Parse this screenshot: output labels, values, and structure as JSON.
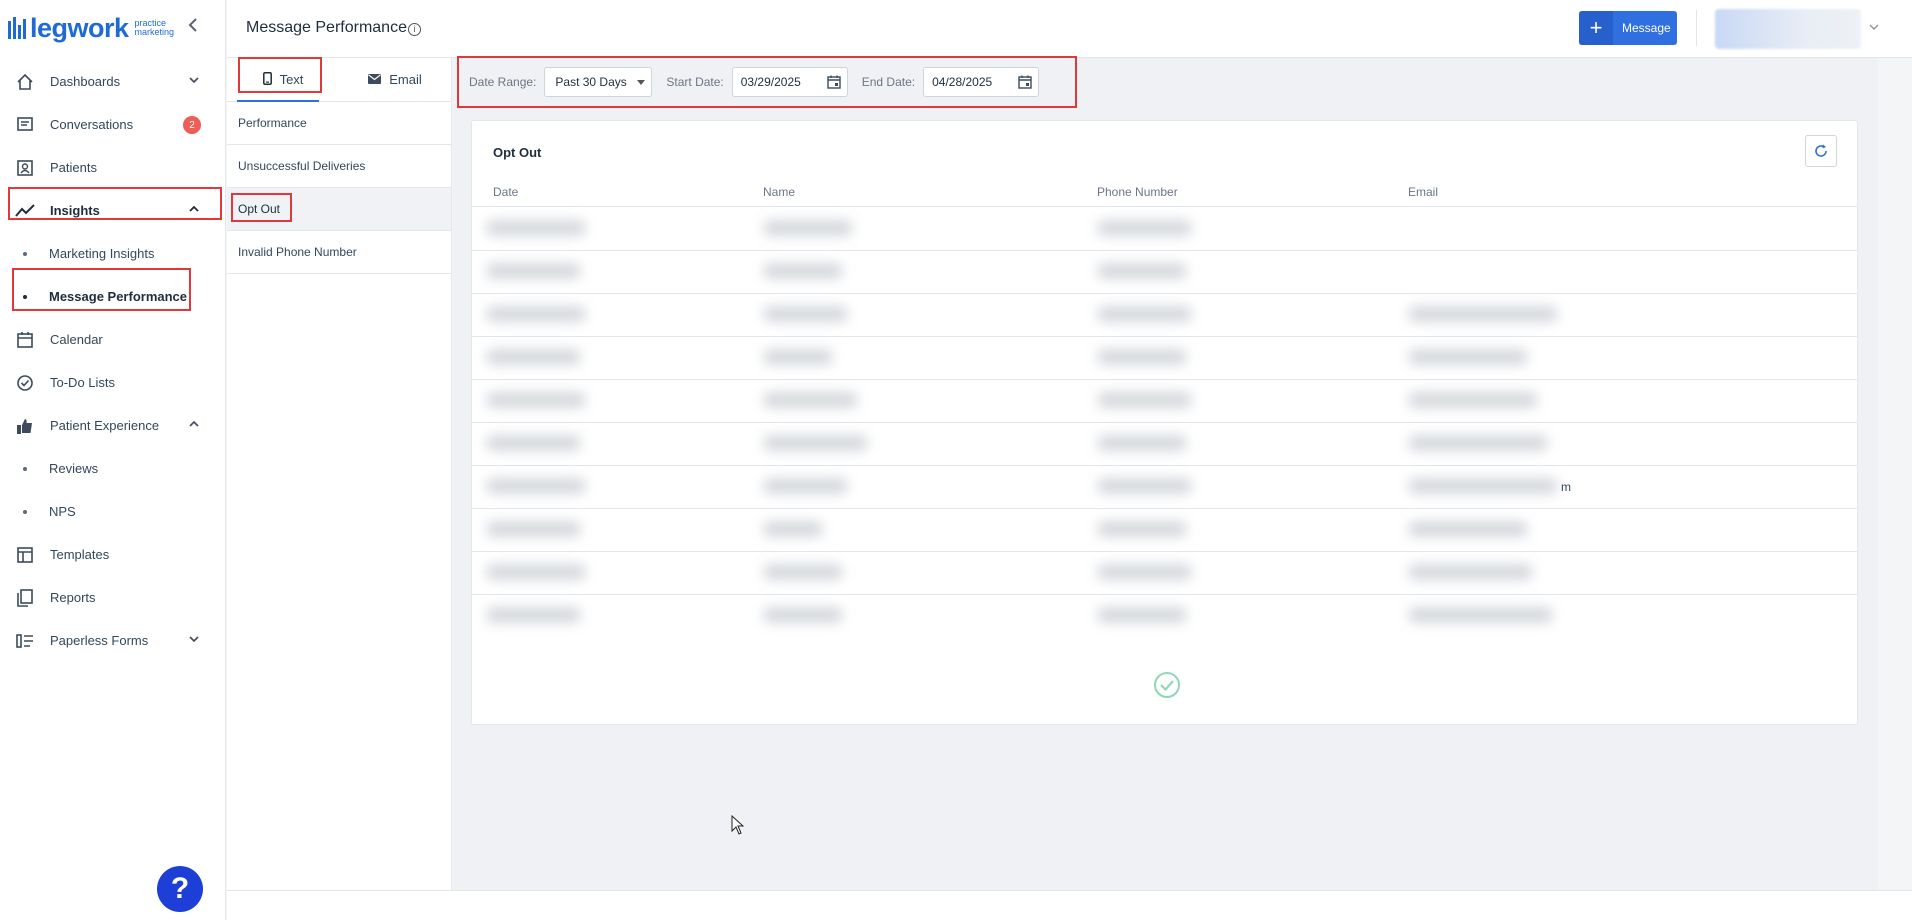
{
  "app": {
    "logo_text": "legwork",
    "logo_sub_1": "practice",
    "logo_sub_2": "marketing"
  },
  "header": {
    "title": "Message Performance",
    "info": "i",
    "message_button": "Message"
  },
  "sidebar": {
    "items": [
      {
        "label": "Dashboards"
      },
      {
        "label": "Conversations",
        "badge": "2"
      },
      {
        "label": "Patients"
      },
      {
        "label": "Insights"
      },
      {
        "label": "Marketing Insights"
      },
      {
        "label": "Message Performance"
      },
      {
        "label": "Calendar"
      },
      {
        "label": "To-Do Lists"
      },
      {
        "label": "Patient Experience"
      },
      {
        "label": "Reviews"
      },
      {
        "label": "NPS"
      },
      {
        "label": "Templates"
      },
      {
        "label": "Reports"
      },
      {
        "label": "Paperless Forms"
      }
    ],
    "help": "?"
  },
  "subnav": {
    "tabs": [
      {
        "label": "Text"
      },
      {
        "label": "Email"
      }
    ],
    "links": [
      {
        "label": "Performance"
      },
      {
        "label": "Unsuccessful Deliveries"
      },
      {
        "label": "Opt Out"
      },
      {
        "label": "Invalid Phone Number"
      }
    ]
  },
  "filters": {
    "date_range_label": "Date Range:",
    "date_range_value": "Past 30 Days",
    "start_label": "Start Date:",
    "start_value": "03/29/2025",
    "end_label": "End Date:",
    "end_value": "04/28/2025"
  },
  "card": {
    "title": "Opt Out",
    "columns": [
      "Date",
      "Name",
      "Phone Number",
      "Email"
    ],
    "row_tail_text": "m"
  },
  "colors": {
    "accent": "#2f6fe0",
    "badge": "#ee5d57",
    "highlight": "#e0393b",
    "help": "#1d3fd8"
  }
}
